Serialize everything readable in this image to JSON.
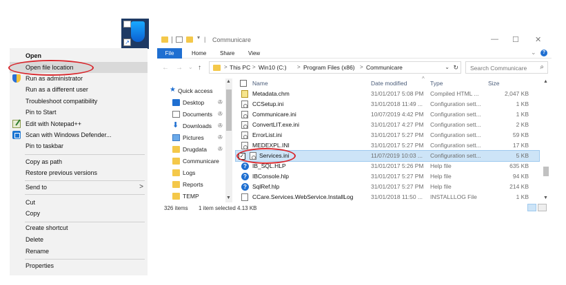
{
  "context_menu": {
    "items": [
      {
        "label": "Open",
        "icon": "",
        "bold": true,
        "highlight": false
      },
      {
        "label": "Open file location",
        "icon": "",
        "bold": false,
        "highlight": true
      },
      {
        "label": "Run as administrator",
        "icon": "shield-icon",
        "bold": false,
        "highlight": false
      },
      {
        "label": "Run as a different user",
        "icon": "",
        "bold": false,
        "highlight": false
      },
      {
        "label": "Troubleshoot compatibility",
        "icon": "",
        "bold": false,
        "highlight": false
      },
      {
        "label": "Pin to Start",
        "icon": "",
        "bold": false,
        "highlight": false
      },
      {
        "label": "Edit with Notepad++",
        "icon": "notepadplusplus-icon",
        "bold": false,
        "highlight": false
      },
      {
        "label": "Scan with Windows Defender...",
        "icon": "windows-defender-icon",
        "bold": false,
        "highlight": false
      },
      {
        "label": "Pin to taskbar",
        "icon": "",
        "bold": false,
        "highlight": false
      },
      {
        "label": "Copy as path",
        "icon": "",
        "bold": false,
        "highlight": false
      },
      {
        "label": "Restore previous versions",
        "icon": "",
        "bold": false,
        "highlight": false
      },
      {
        "label": "Send to",
        "icon": "",
        "bold": false,
        "highlight": false,
        "submenu": true
      },
      {
        "label": "Cut",
        "icon": "",
        "bold": false,
        "highlight": false
      },
      {
        "label": "Copy",
        "icon": "",
        "bold": false,
        "highlight": false
      },
      {
        "label": "Create shortcut",
        "icon": "",
        "bold": false,
        "highlight": false
      },
      {
        "label": "Delete",
        "icon": "",
        "bold": false,
        "highlight": false
      },
      {
        "label": "Rename",
        "icon": "",
        "bold": false,
        "highlight": false
      },
      {
        "label": "Properties",
        "icon": "",
        "bold": false,
        "highlight": false
      }
    ],
    "submenu_arrow": ">"
  },
  "explorer": {
    "title": "Communicare",
    "title_sep": "|",
    "window_buttons": {
      "minimize": "—",
      "maximize": "☐",
      "close": "✕"
    },
    "ribbon": {
      "file": "File",
      "tabs": [
        "Home",
        "Share",
        "View"
      ],
      "expand": "⌄",
      "help": "?"
    },
    "nav_buttons": {
      "back": "←",
      "forward": "→",
      "recent": "⌄",
      "up": "↑"
    },
    "address": {
      "crumbs": [
        "This PC",
        "Win10 (C:)",
        "Program Files (x86)",
        "Communicare"
      ],
      "chevron": ">",
      "dropdown": "⌄",
      "refresh": "↻"
    },
    "search": {
      "placeholder": "Search Communicare",
      "icon": "⌕"
    },
    "nav_pane": [
      {
        "label": "Quick access",
        "icon": "star-icon",
        "pinned": false
      },
      {
        "label": "Desktop",
        "icon": "desktop-icon",
        "pinned": true
      },
      {
        "label": "Documents",
        "icon": "documents-icon",
        "pinned": true
      },
      {
        "label": "Downloads",
        "icon": "download-icon",
        "pinned": true
      },
      {
        "label": "Pictures",
        "icon": "pictures-icon",
        "pinned": true
      },
      {
        "label": "Drugdata",
        "icon": "folder-icon",
        "pinned": true
      },
      {
        "label": "Communicare",
        "icon": "folder-icon",
        "pinned": false
      },
      {
        "label": "Logs",
        "icon": "folder-icon",
        "pinned": false
      },
      {
        "label": "Reports",
        "icon": "folder-icon",
        "pinned": false
      },
      {
        "label": "TEMP",
        "icon": "folder-icon",
        "pinned": false
      }
    ],
    "pin_glyph": "✇",
    "columns": {
      "name": "Name",
      "date": "Date modified",
      "type": "Type",
      "size": "Size",
      "sort_caret": "^"
    },
    "files": [
      {
        "name": "Metadata.chm",
        "date": "31/01/2017 5:08 PM",
        "type": "Compiled HTML ...",
        "size": "2,047 KB",
        "icon": "chm",
        "selected": false
      },
      {
        "name": "CCSetup.ini",
        "date": "31/01/2018 11:49 ...",
        "type": "Configuration sett...",
        "size": "1 KB",
        "icon": "cfg",
        "selected": false
      },
      {
        "name": "Communicare.ini",
        "date": "10/07/2019 4:42 PM",
        "type": "Configuration sett...",
        "size": "1 KB",
        "icon": "cfg",
        "selected": false
      },
      {
        "name": "ConvertLIT.exe.ini",
        "date": "31/01/2017 4:27 PM",
        "type": "Configuration sett...",
        "size": "2 KB",
        "icon": "cfg",
        "selected": false
      },
      {
        "name": "ErrorList.ini",
        "date": "31/01/2017 5:27 PM",
        "type": "Configuration sett...",
        "size": "59 KB",
        "icon": "cfg",
        "selected": false
      },
      {
        "name": "MEDEXPL.INI",
        "date": "31/01/2017 5:27 PM",
        "type": "Configuration sett...",
        "size": "17 KB",
        "icon": "cfg",
        "selected": false
      },
      {
        "name": "Services.ini",
        "date": "11/07/2019 10:03 ...",
        "type": "Configuration sett...",
        "size": "5 KB",
        "icon": "cfg",
        "selected": true
      },
      {
        "name": "IB_SQL.HLP",
        "date": "31/01/2017 5:26 PM",
        "type": "Help file",
        "size": "635 KB",
        "icon": "hlp",
        "selected": false
      },
      {
        "name": "IBConsole.hlp",
        "date": "31/01/2017 5:27 PM",
        "type": "Help file",
        "size": "94 KB",
        "icon": "hlp",
        "selected": false
      },
      {
        "name": "SqlRef.hlp",
        "date": "31/01/2017 5:27 PM",
        "type": "Help file",
        "size": "214 KB",
        "icon": "hlp",
        "selected": false
      },
      {
        "name": "CCare.Services.WebService.InstallLog",
        "date": "31/01/2018 11:50 ...",
        "type": "INSTALLLOG File",
        "size": "1 KB",
        "icon": "log",
        "selected": false
      }
    ],
    "status": {
      "count": "326 items",
      "selection": "1 item selected  4.13 KB"
    },
    "selected_checkbox": "✓"
  },
  "colors": {
    "accent": "#1f6fd1",
    "annotation": "#d8262c",
    "selection": "#cde4f7",
    "menu_bg": "#f2f2f2"
  }
}
